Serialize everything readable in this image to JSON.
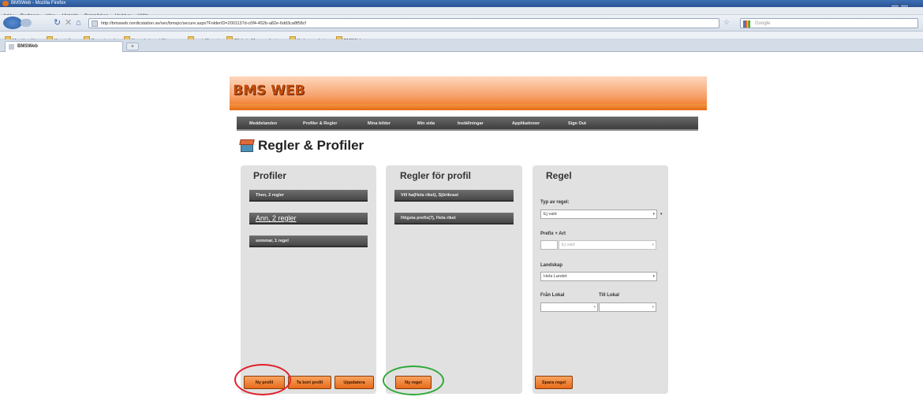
{
  "browser": {
    "window_title": "BMSWeb - Mozilla Firefox",
    "menu": [
      "Arkiv",
      "Redigera",
      "Visa",
      "Historik",
      "Bokmärken",
      "Verktyg",
      "Hjälp"
    ],
    "url": "http://bmsweb.nordicstation.se/sec/bmspc/secure.aspx?FolderID=2001137d-c0f4-452b-a82e-6dd3ca8f58cf",
    "search_placeholder": "Google",
    "bookmarks": [
      "Mest besökta",
      "Kom igång",
      "Senaste nytt",
      "Kungsholmen | Stagne...",
      "portalSuomi",
      "Filabel - Massor af uni...",
      "Umbraco - login",
      "BMSWeb"
    ],
    "tab_title": "BMSWeb",
    "new_tab_label": "+"
  },
  "site": {
    "logo": "BMS WEB",
    "nav": [
      "Meddelanden",
      "Profiler & Regler",
      "Mina bilder",
      "Min sida",
      "Inställningar",
      "Applikationer",
      "Sign Out"
    ]
  },
  "page": {
    "title": "Regler & Profiler"
  },
  "profiler": {
    "title": "Profiler",
    "items": [
      "Then, 2 regler",
      "Ann, 2 regler",
      "sommar, 1 regel"
    ],
    "buttons": {
      "new": "Ny profil",
      "delete": "Ta bort profil",
      "update": "Uppdatera"
    }
  },
  "regler": {
    "title": "Regler för profil",
    "items": [
      "Vill ha(Hela riket), Sjörikrast",
      "Högsta prefix(7), Hela riket"
    ],
    "buttons": {
      "new": "Ny regel"
    }
  },
  "regel": {
    "title": "Regel",
    "type_label": "Typ av regel:",
    "type_value": "Ej vald",
    "prefix_label": "Prefix + Art",
    "prefix_select_value": "Ej vald",
    "landskap_label": "Landskap",
    "landskap_value": "Hela Landet",
    "from_label": "Från Lokal",
    "to_label": "Till Lokal",
    "buttons": {
      "save": "Spara regel"
    }
  },
  "annotations": {
    "red_circle_color": "#e0202a",
    "green_circle_color": "#2fa836"
  }
}
